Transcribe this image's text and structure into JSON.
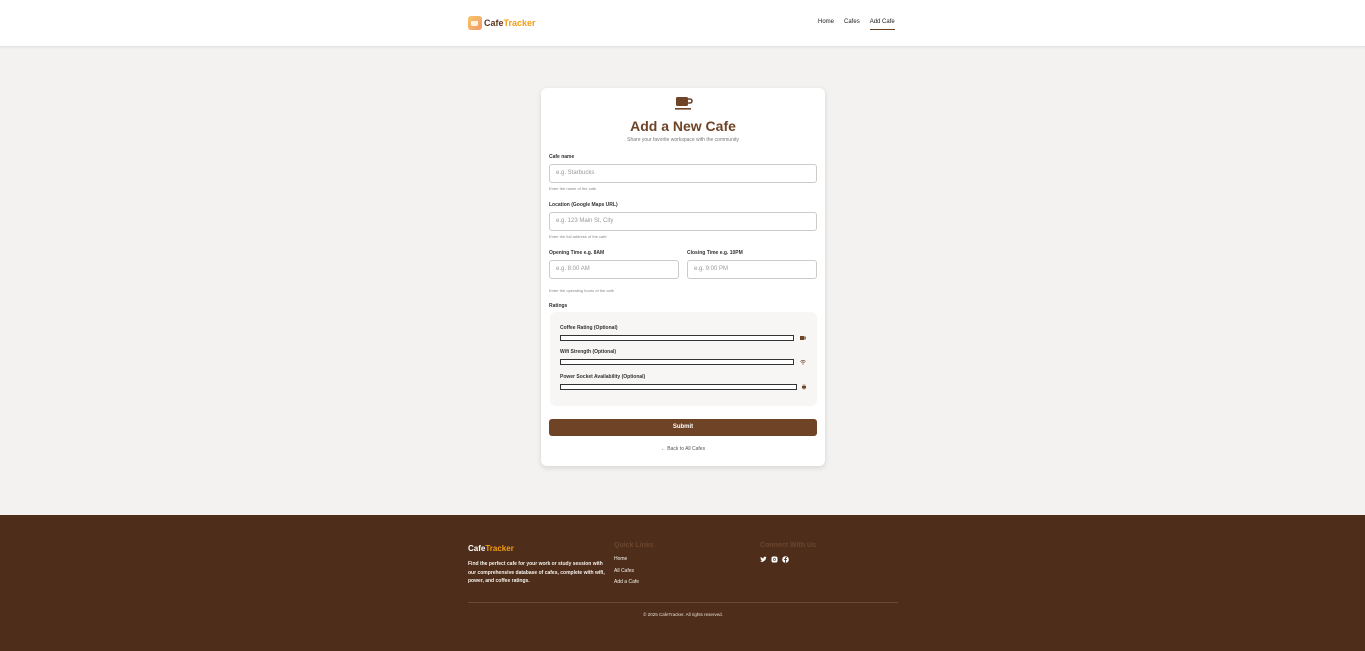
{
  "header": {
    "brand_part1": "Cafe",
    "brand_part2": "Tracker",
    "nav": [
      "Home",
      "Cafes",
      "Add Cafe"
    ],
    "active_nav": "Add Cafe"
  },
  "form": {
    "title": "Add a New Cafe",
    "subtitle": "Share your favorite workspace with the community",
    "cafe_name": {
      "label": "Cafe name",
      "placeholder": "e.g. Starbucks",
      "help": "Enter the name of the cafe"
    },
    "location": {
      "label": "Location (Google Maps URL)",
      "placeholder": "e.g. 123 Main St, City",
      "help": "Enter the full address of the cafe"
    },
    "opening": {
      "label": "Opening Time e.g. 8AM",
      "placeholder": "e.g. 8:00 AM"
    },
    "closing": {
      "label": "Closing Time e.g. 10PM",
      "placeholder": "e.g. 9:00 PM"
    },
    "hours_help": "Enter the operating hours of the cafe",
    "ratings_label": "Ratings",
    "ratings": [
      {
        "label": "Coffee Rating (Optional)",
        "icon": "coffee-icon"
      },
      {
        "label": "Wifi Strength (Optional)",
        "icon": "wifi-icon"
      },
      {
        "label": "Power Socket Availability (Optional)",
        "icon": "plug-icon"
      }
    ],
    "submit_label": "Submit",
    "back_link": "← Back to All Cafes"
  },
  "footer": {
    "brand_part1": "Cafe",
    "brand_part2": "Tracker",
    "description": "Find the perfect cafe for your work or study session with our comprehensive database of cafes, complete with wifi, power, and coffee ratings.",
    "quick_links_heading": "Quick Links",
    "quick_links": [
      "Home",
      "All Cafes",
      "Add a Cafe"
    ],
    "connect_heading": "Connect With Us",
    "social_icons": [
      "twitter-icon",
      "instagram-icon",
      "facebook-icon"
    ],
    "copyright": "© 2025 CafeTracker. All rights reserved."
  },
  "colors": {
    "brand_brown": "#6f4326",
    "accent_orange": "#f39c12",
    "footer_bg": "#4e2e1a"
  }
}
